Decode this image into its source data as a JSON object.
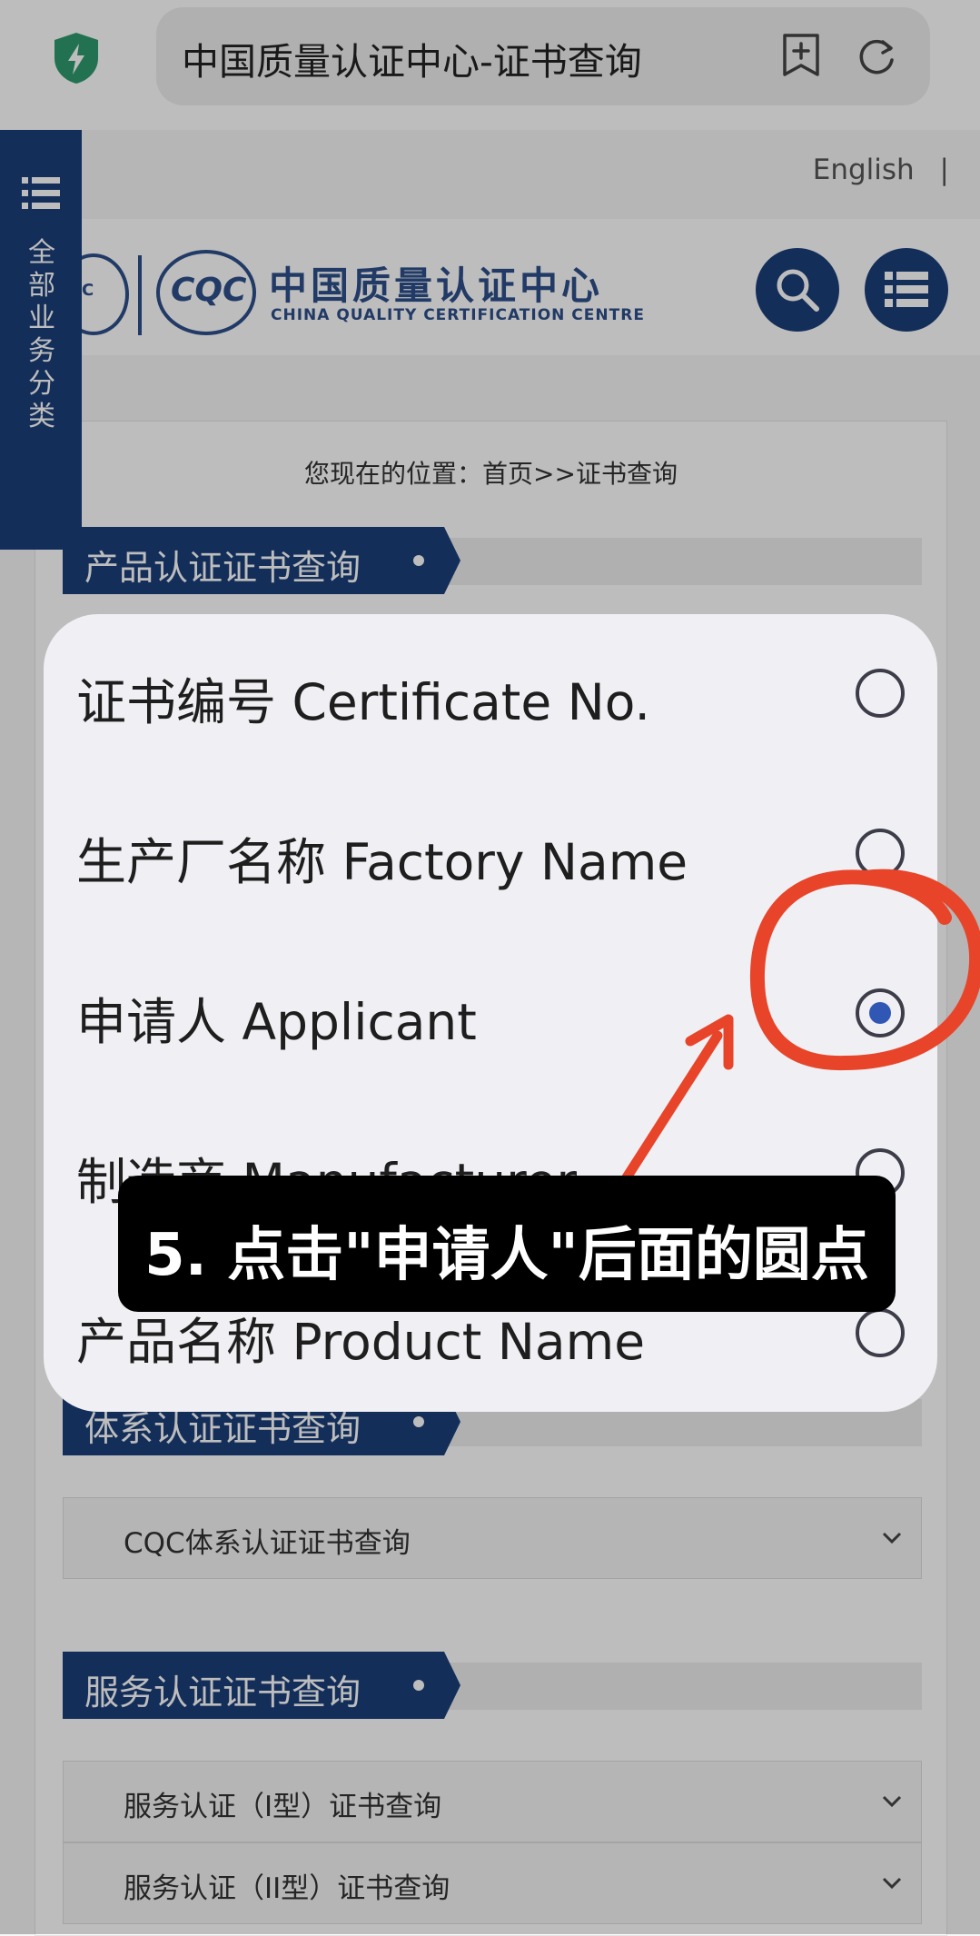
{
  "browser": {
    "page_title": "中国质量认证中心-证书查询"
  },
  "header": {
    "language_link": "English",
    "language_separator": "|",
    "logo_left_text": "C",
    "logo_cqc_text": "CQC",
    "org_name_cn": "中国质量认证中心",
    "org_name_en": "CHINA QUALITY CERTIFICATION CENTRE"
  },
  "sidetab": {
    "label": "全部业务分类"
  },
  "breadcrumb": "您现在的位置：首页>>证书查询",
  "sections": {
    "product_title": "产品认证证书查询",
    "system_title": "体系认证证书查询",
    "system_rows": [
      "CQC体系认证证书查询"
    ],
    "service_title": "服务认证证书查询",
    "service_rows": [
      "服务认证（I型）证书查询",
      "服务认证（II型）证书查询"
    ]
  },
  "picker": {
    "options": [
      {
        "label": "证书编号 Certificate No.",
        "selected": false
      },
      {
        "label": "生产厂名称 Factory Name",
        "selected": false
      },
      {
        "label": "申请人 Applicant",
        "selected": true
      },
      {
        "label": "制造商 Manufacturer",
        "selected": false
      },
      {
        "label": "产品名称 Product Name",
        "selected": false
      }
    ]
  },
  "caption": "5. 点击\"申请人\"后面的圆点",
  "colors": {
    "brand_blue": "#1b3f7a",
    "radio_selected": "#3157b5",
    "annotation_red": "#e8442a"
  }
}
